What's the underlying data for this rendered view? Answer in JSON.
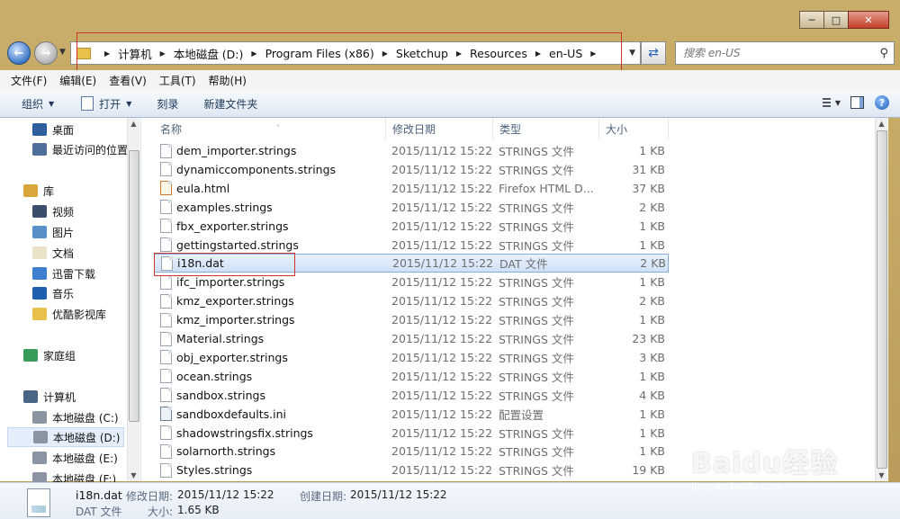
{
  "window": {
    "caption_buttons": [
      "─",
      "□",
      "✕"
    ]
  },
  "address_bar": {
    "breadcrumbs": [
      "计算机",
      "本地磁盘 (D:)",
      "Program Files (x86)",
      "Sketchup",
      "Resources",
      "en-US"
    ]
  },
  "search": {
    "placeholder": "搜索 en-US"
  },
  "menu": {
    "items": [
      "文件(F)",
      "编辑(E)",
      "查看(V)",
      "工具(T)",
      "帮助(H)"
    ]
  },
  "toolbar": {
    "organize": "组织",
    "open": "打开",
    "burn": "刻录",
    "new_folder": "新建文件夹"
  },
  "sidebar": {
    "items": [
      {
        "label": "桌面",
        "icon": "desktop-icon"
      },
      {
        "label": "最近访问的位置",
        "icon": "recent-places-icon"
      },
      {
        "label": "库",
        "icon": "library-icon"
      },
      {
        "label": "视频",
        "icon": "video-icon"
      },
      {
        "label": "图片",
        "icon": "pictures-icon"
      },
      {
        "label": "文档",
        "icon": "documents-icon"
      },
      {
        "label": "迅雷下载",
        "icon": "download-icon"
      },
      {
        "label": "音乐",
        "icon": "music-icon"
      },
      {
        "label": "优酷影视库",
        "icon": "folder-icon"
      },
      {
        "label": "家庭组",
        "icon": "homegroup-icon"
      },
      {
        "label": "计算机",
        "icon": "computer-icon"
      },
      {
        "label": "本地磁盘 (C:)",
        "icon": "drive-icon"
      },
      {
        "label": "本地磁盘 (D:)",
        "icon": "drive-icon"
      },
      {
        "label": "本地磁盘 (E:)",
        "icon": "drive-icon"
      },
      {
        "label": "本地磁盘 (F:)",
        "icon": "drive-icon"
      }
    ]
  },
  "columns": {
    "name": "名称",
    "date": "修改日期",
    "type": "类型",
    "size": "大小"
  },
  "files": [
    {
      "name": "dem_importer.strings",
      "date": "2015/11/12 15:22",
      "type": "STRINGS 文件",
      "size": "1 KB"
    },
    {
      "name": "dynamiccomponents.strings",
      "date": "2015/11/12 15:22",
      "type": "STRINGS 文件",
      "size": "31 KB"
    },
    {
      "name": "eula.html",
      "date": "2015/11/12 15:22",
      "type": "Firefox HTML D...",
      "size": "37 KB"
    },
    {
      "name": "examples.strings",
      "date": "2015/11/12 15:22",
      "type": "STRINGS 文件",
      "size": "2 KB"
    },
    {
      "name": "fbx_exporter.strings",
      "date": "2015/11/12 15:22",
      "type": "STRINGS 文件",
      "size": "1 KB"
    },
    {
      "name": "gettingstarted.strings",
      "date": "2015/11/12 15:22",
      "type": "STRINGS 文件",
      "size": "1 KB"
    },
    {
      "name": "i18n.dat",
      "date": "2015/11/12 15:22",
      "type": "DAT 文件",
      "size": "2 KB"
    },
    {
      "name": "ifc_importer.strings",
      "date": "2015/11/12 15:22",
      "type": "STRINGS 文件",
      "size": "1 KB"
    },
    {
      "name": "kmz_exporter.strings",
      "date": "2015/11/12 15:22",
      "type": "STRINGS 文件",
      "size": "2 KB"
    },
    {
      "name": "kmz_importer.strings",
      "date": "2015/11/12 15:22",
      "type": "STRINGS 文件",
      "size": "1 KB"
    },
    {
      "name": "Material.strings",
      "date": "2015/11/12 15:22",
      "type": "STRINGS 文件",
      "size": "23 KB"
    },
    {
      "name": "obj_exporter.strings",
      "date": "2015/11/12 15:22",
      "type": "STRINGS 文件",
      "size": "3 KB"
    },
    {
      "name": "ocean.strings",
      "date": "2015/11/12 15:22",
      "type": "STRINGS 文件",
      "size": "1 KB"
    },
    {
      "name": "sandbox.strings",
      "date": "2015/11/12 15:22",
      "type": "STRINGS 文件",
      "size": "4 KB"
    },
    {
      "name": "sandboxdefaults.ini",
      "date": "2015/11/12 15:22",
      "type": "配置设置",
      "size": "1 KB"
    },
    {
      "name": "shadowstringsfix.strings",
      "date": "2015/11/12 15:22",
      "type": "STRINGS 文件",
      "size": "1 KB"
    },
    {
      "name": "solarnorth.strings",
      "date": "2015/11/12 15:22",
      "type": "STRINGS 文件",
      "size": "1 KB"
    },
    {
      "name": "Styles.strings",
      "date": "2015/11/12 15:22",
      "type": "STRINGS 文件",
      "size": "19 KB"
    }
  ],
  "selected_index": 6,
  "details": {
    "name": "i18n.dat",
    "type": "DAT 文件",
    "modified_label": "修改日期:",
    "modified_value": "2015/11/12 15:22",
    "created_label": "创建日期:",
    "created_value": "2015/11/12 15:22",
    "size_label": "大小:",
    "size_value": "1.65 KB"
  },
  "watermark": {
    "brand": "Baidu经验",
    "url": "jingyan.baidu.com"
  },
  "colors": {
    "highlight_red": "#d0352d",
    "selection_blue": "#cfe1f7",
    "window_frame": "#c7a866"
  }
}
